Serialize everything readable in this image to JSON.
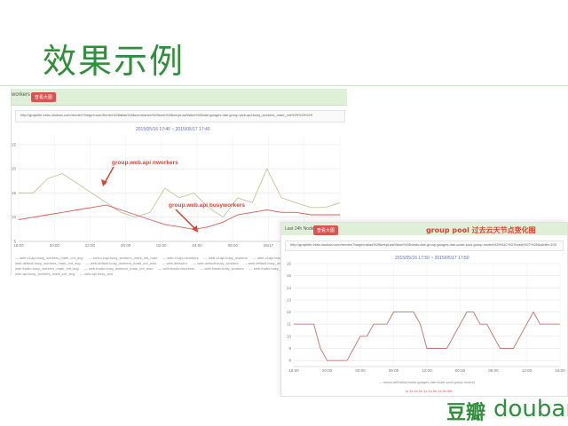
{
  "slide": {
    "title": "效果示例",
    "logo_cn": "豆瓣",
    "logo_en": "douban"
  },
  "panel1": {
    "title": "workers",
    "button_label": "查看大图",
    "url": "http://graphite.intra.douban.com/render/?target=sumSeries%28alias%28summarize%28sum%28keepLastValue%28dae.gauges.dae.group.web-api.busy_workers_mark_cnt%29%29%29",
    "time_range": "2015/05/16 17:40 ~ 2015/05/17 17:40",
    "annotation_a": "group.web.api nworkers",
    "annotation_b": "group.web.api  busyworkers",
    "legend": [
      "web-c1api.busy_workers_mark_cnt_avg",
      "web-c1api.busy_workers_mark_cnt_max",
      "web-c1api.nworkers",
      "web-c1api.busy_workers",
      "web-c1api.busy_workers_mark_cnt",
      "web.default.busy_workers_mark_cnt_avg",
      "web.default.busy_workers_mark_cnt_max",
      "web.default.n",
      "web.default.busy_workers",
      "web.default.busy_workers_mark_cnt",
      "web.fradio.busy_workers_mark_cnt_avg",
      "web.fradio.busy_workers_mark_cnt_max",
      "web.fradio.nworkers",
      "web.fradio.busy_workers",
      "web.fradio.busy_workers_mark_cnt",
      "web.api.busy_workers_mark_cnt_avg",
      "web.api.busy_wor"
    ]
  },
  "panel2": {
    "title": "Last 24h Nodes",
    "button_label": "查看大图",
    "caption": "group pool 过去云天节点变化图",
    "url": "http://graphite.intra.douban.com/render/?target=alias%28keepLastValue%28hosts.dae.group.gauges.dae.scale.pool.group.nodes%29%2C%27hosts%27%29&width=1000&from=-24hours",
    "time_range": "2015/05/16 17:50 ~ 2015/05/17 17:50",
    "legend": "— keepLastValue(hosts.gauges.dae.scale.pool.group.nodes)",
    "colors_row": "io  3x  4x  0x  1x  1x  5x  1x  5x  9hi"
  },
  "chart_data": [
    {
      "type": "line",
      "title": "",
      "time_range": "2015/05/16 17:40 ~ 2015/05/17 17:40",
      "x": [
        "18:00",
        "20:00",
        "22:00",
        "00:00",
        "02:00",
        "04:00",
        "06:00",
        "05/17",
        "10:00",
        "12:00"
      ],
      "y_ticks": [
        5,
        10,
        15,
        20,
        25
      ],
      "ylim": [
        5,
        27
      ],
      "grid": true,
      "series": [
        {
          "name": "group.web.api nworkers",
          "color": "#c8c29a",
          "values": [
            15,
            15,
            18,
            19,
            17,
            15,
            13,
            11,
            10,
            11,
            16,
            14,
            15,
            12,
            10,
            14,
            13,
            20,
            14,
            13,
            12,
            12,
            13
          ]
        },
        {
          "name": "group.web.api  busyworkers",
          "color": "#e05a55",
          "values": [
            9.5,
            10,
            10.5,
            11,
            11.5,
            12,
            12.5,
            11.5,
            10.5,
            9.5,
            8.5,
            8,
            7.5,
            8,
            9,
            10.5,
            11,
            11.5,
            11,
            11,
            10.5,
            10.5,
            10.5
          ]
        }
      ]
    },
    {
      "type": "line",
      "title": "",
      "time_range": "2015/05/16 17:50 ~ 2015/05/17 17:50",
      "x": [
        "18:00",
        "20:00",
        "00:00",
        "06:00",
        "12:00",
        "00:00",
        "08:00",
        "12:00",
        "16:00"
      ],
      "y_ticks": [
        8,
        9,
        10,
        11,
        12,
        13,
        14,
        15,
        16
      ],
      "ylim": [
        7.5,
        16
      ],
      "grid": true,
      "series": [
        {
          "name": "keepLastValue(hosts.gauges.dae.scale.pool.group.nodes)",
          "color": "#c9706a",
          "values": [
            11,
            11,
            11,
            11,
            9,
            8,
            8,
            8,
            8,
            9,
            10,
            10,
            11,
            11,
            11,
            12,
            12,
            12,
            12,
            11,
            9,
            9,
            9,
            9,
            10,
            11,
            12,
            12,
            11,
            11,
            10,
            9,
            9,
            9,
            10,
            11,
            12,
            11,
            11,
            11,
            11
          ]
        }
      ]
    }
  ]
}
